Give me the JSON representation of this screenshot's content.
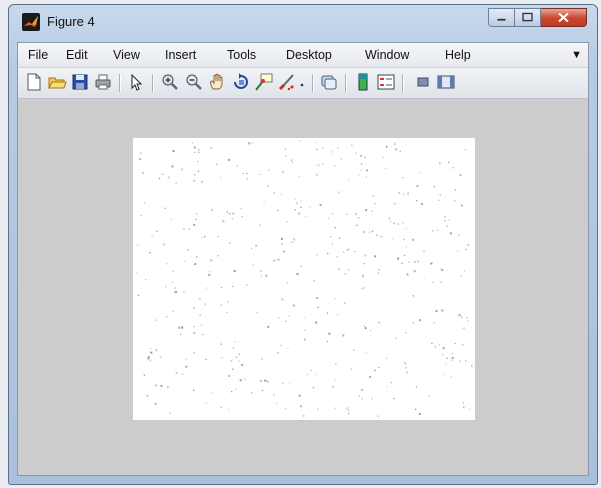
{
  "window": {
    "title": "Figure 4"
  },
  "menu": {
    "items": [
      "File",
      "Edit",
      "View",
      "Insert",
      "Tools",
      "Desktop",
      "Window",
      "Help"
    ]
  },
  "toolbar": {
    "buttons": [
      "new-figure-icon",
      "open-file-icon",
      "save-icon",
      "print-icon",
      "pointer-icon",
      "zoom-in-icon",
      "zoom-out-icon",
      "pan-icon",
      "rotate-3d-icon",
      "data-cursor-icon",
      "brush-icon",
      "brush-dropdown-icon",
      "link-plot-icon",
      "colorbar-icon",
      "legend-icon",
      "hide-plot-tools-icon",
      "show-plot-tools-icon"
    ]
  },
  "plot": {
    "description_type": "binary-image",
    "background": "#ffffff",
    "dot_color": "#8a8a8a",
    "dot_count": 420
  },
  "colors": {
    "figure_bg": "#cccccc",
    "close_button": "#c9452f"
  }
}
